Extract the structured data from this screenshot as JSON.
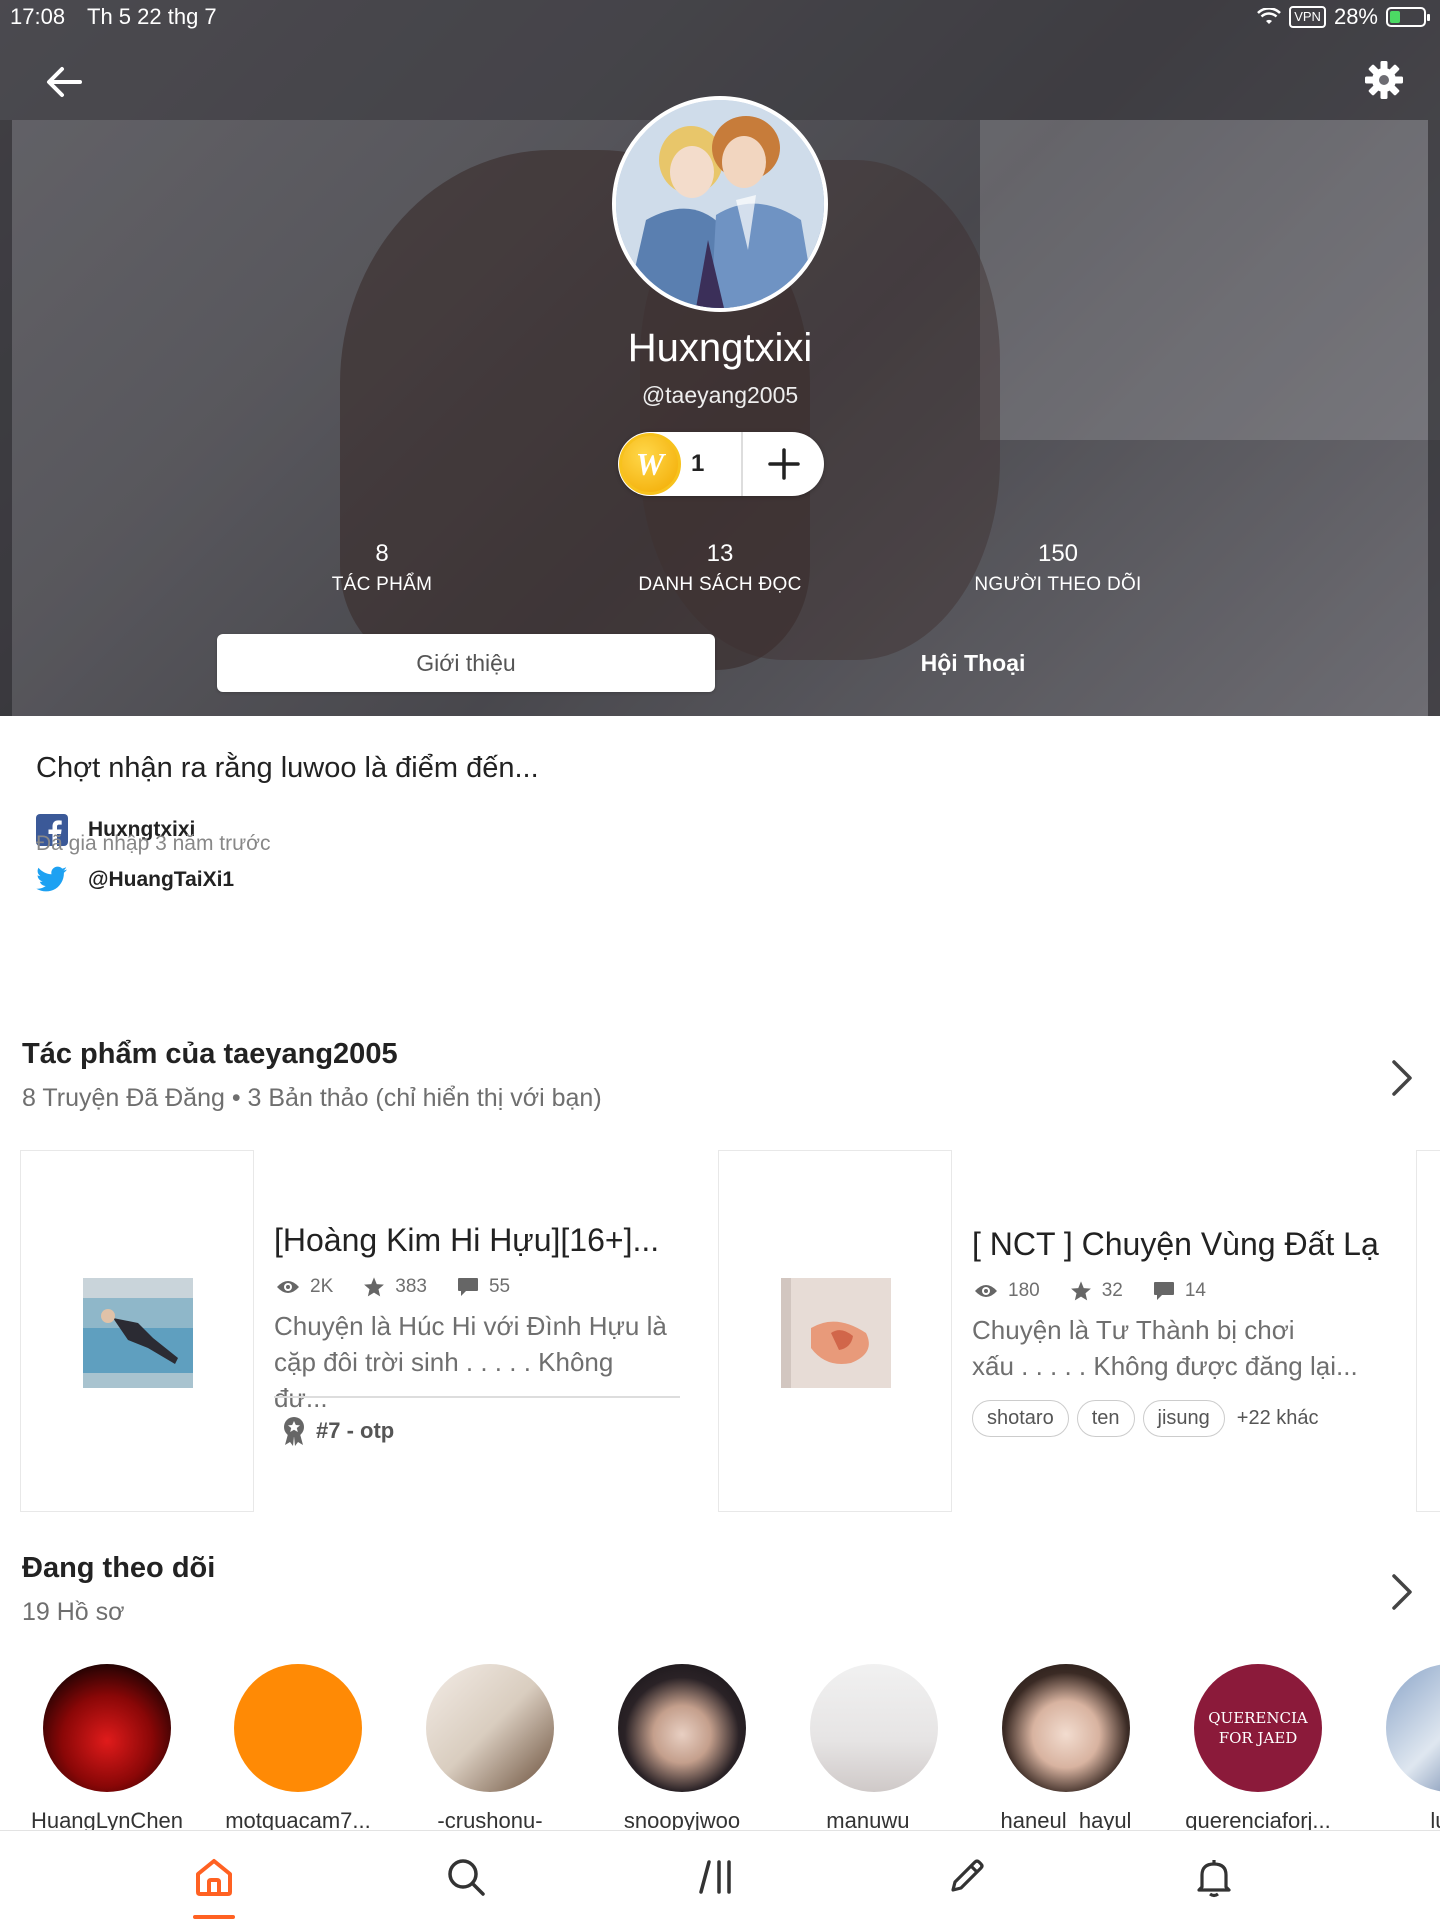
{
  "status_bar": {
    "time": "17:08",
    "date": "Th 5 22 thg 7",
    "vpn": "VPN",
    "battery": "28%"
  },
  "header": {
    "back_icon": "arrow-left-icon",
    "settings_icon": "gear-icon"
  },
  "profile": {
    "display_name": "Huxngtxixi",
    "username": "@taeyang2005",
    "coin_symbol": "W",
    "coin_count": "1",
    "stats": [
      {
        "value": "8",
        "label": "TÁC PHẨM"
      },
      {
        "value": "13",
        "label": "DANH SÁCH ĐỌC"
      },
      {
        "value": "150",
        "label": "NGƯỜI THEO DÕI"
      }
    ],
    "tabs": [
      {
        "label": "Giới thiệu",
        "active": true
      },
      {
        "label": "Hội Thoại",
        "active": false
      }
    ]
  },
  "about": {
    "bio": "Chợt nhận ra rằng luwoo là điểm đến...",
    "facebook": "Huxngtxixi",
    "joined": "Đã gia nhập 3 năm trước",
    "twitter": "@HuangTaiXi1"
  },
  "works": {
    "title": "Tác phẩm của taeyang2005",
    "subtitle": "8 Truyện Đã Đăng • 3 Bản thảo (chỉ hiển thị với bạn)",
    "items": [
      {
        "title": "[Hoàng Kim Hi Hựu][16+]...",
        "reads": "2K",
        "votes": "383",
        "comments": "55",
        "desc_line1": "Chuyện là Húc Hi với Đình Hựu là",
        "desc_line2": "cặp đôi trời sinh . . . . . Không đư...",
        "ranking": "#7 - otp"
      },
      {
        "title": "[ NCT ] Chuyện Vùng Đất Lạ",
        "reads": "180",
        "votes": "32",
        "comments": "14",
        "desc_line1": "Chuyện là Tư Thành bị chơi",
        "desc_line2": "xấu . . . . . Không được đăng lại...",
        "tags": [
          "shotaro",
          "ten",
          "jisung"
        ],
        "tags_more": "+22 khác"
      }
    ]
  },
  "following": {
    "title": "Đang theo dõi",
    "subtitle": "19 Hồ sơ",
    "users": [
      {
        "name": "HuangLynChen"
      },
      {
        "name": "motquacam7..."
      },
      {
        "name": "-crushonu-"
      },
      {
        "name": "snoopyjwoo"
      },
      {
        "name": "manuwu_"
      },
      {
        "name": "haneul_hayul"
      },
      {
        "name": "querenciaforj..."
      },
      {
        "name": "lulul"
      }
    ],
    "logo_text_1": "QUERENCIA",
    "logo_text_2": "FOR JAED"
  },
  "bottom_nav": {
    "items": [
      "home-icon",
      "search-icon",
      "library-icon",
      "pencil-icon",
      "bell-icon"
    ],
    "accent_color": "#ff6122"
  }
}
